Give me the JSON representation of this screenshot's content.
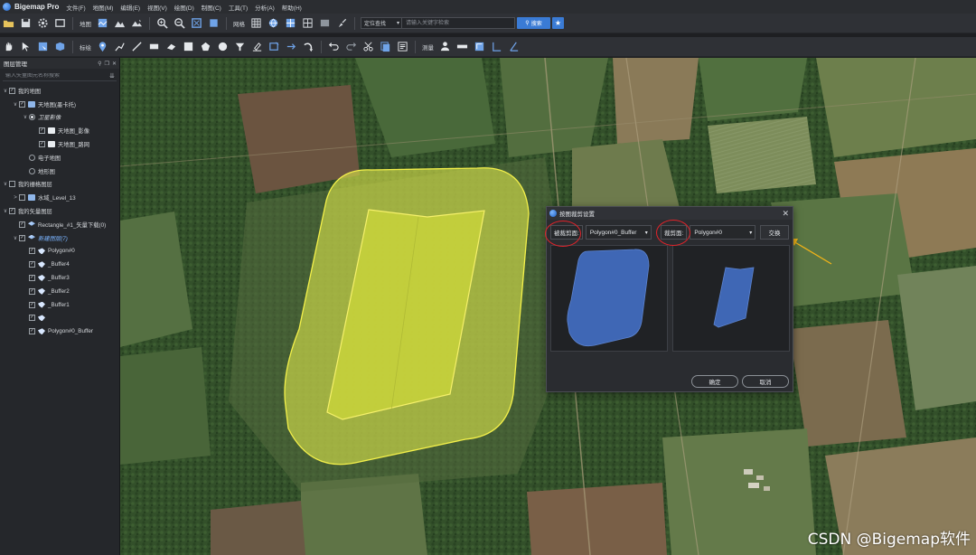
{
  "app": {
    "title": "Bigemap Pro",
    "menu": [
      "文件(F)",
      "地图(M)",
      "编辑(E)",
      "视图(V)",
      "绘图(D)",
      "制图(C)",
      "工具(T)",
      "分析(A)",
      "帮助(H)"
    ]
  },
  "toolbar1": {
    "map_label": "地图",
    "grid_label": "网格",
    "locate_select": "定位查找",
    "search_placeholder": "请输入关键字检索",
    "search_button": "搜索"
  },
  "toolbar2": {
    "plot_label": "标绘",
    "measure_label": "测量"
  },
  "layer_panel": {
    "title": "图层管理",
    "search_placeholder": "输入矢量图元名称搜索",
    "tree": [
      {
        "label": "我的地图",
        "level": 0,
        "expander": "∨",
        "control": "check",
        "checked": true,
        "icon": "none"
      },
      {
        "label": "天地图(墨卡托)",
        "level": 1,
        "expander": "∨",
        "control": "check",
        "checked": true,
        "icon": "folder"
      },
      {
        "label": "卫星影像",
        "level": 2,
        "expander": "∨",
        "control": "radio",
        "checked": true,
        "icon": "none",
        "style": "italic"
      },
      {
        "label": "天地图_影像",
        "level": 3,
        "expander": "",
        "control": "check",
        "checked": true,
        "icon": "map"
      },
      {
        "label": "天地图_路网",
        "level": 3,
        "expander": "",
        "control": "check",
        "checked": true,
        "icon": "map"
      },
      {
        "label": "电子地图",
        "level": 2,
        "expander": "",
        "control": "radio",
        "checked": false,
        "icon": "none"
      },
      {
        "label": "地形图",
        "level": 2,
        "expander": "",
        "control": "radio",
        "checked": false,
        "icon": "none"
      },
      {
        "label": "我的栅格图层",
        "level": 0,
        "expander": "∨",
        "control": "check",
        "checked": false,
        "icon": "none"
      },
      {
        "label": "水域_Level_13",
        "level": 1,
        "expander": ">",
        "control": "check",
        "checked": false,
        "icon": "folder"
      },
      {
        "label": "我的矢量图层",
        "level": 0,
        "expander": "∨",
        "control": "check",
        "checked": true,
        "icon": "none"
      },
      {
        "label": "Rectangle_#1_矢量下载(0)",
        "level": 1,
        "expander": "",
        "control": "check",
        "checked": true,
        "icon": "layer"
      },
      {
        "label": "新建图层(7)",
        "level": 1,
        "expander": "∨",
        "control": "check",
        "checked": true,
        "icon": "layer",
        "style": "blue"
      },
      {
        "label": "Polygon#0",
        "level": 2,
        "expander": "",
        "control": "check",
        "checked": true,
        "icon": "poly"
      },
      {
        "label": "_Buffer4",
        "level": 2,
        "expander": "",
        "control": "check",
        "checked": true,
        "icon": "poly"
      },
      {
        "label": "_Buffer3",
        "level": 2,
        "expander": "",
        "control": "check",
        "checked": true,
        "icon": "poly"
      },
      {
        "label": "_Buffer2",
        "level": 2,
        "expander": "",
        "control": "check",
        "checked": true,
        "icon": "poly"
      },
      {
        "label": "_Buffer1",
        "level": 2,
        "expander": "",
        "control": "check",
        "checked": true,
        "icon": "poly"
      },
      {
        "label": "",
        "level": 2,
        "expander": "",
        "control": "check",
        "checked": true,
        "icon": "poly"
      },
      {
        "label": "Polygon#0_Buffer",
        "level": 2,
        "expander": "",
        "control": "check",
        "checked": true,
        "icon": "poly"
      }
    ]
  },
  "dialog": {
    "title": "按图裁剪设置",
    "target_label": "被裁剪面:",
    "target_value": "Polygon#0_Buffer",
    "clip_label": "裁剪面:",
    "clip_value": "Polygon#0",
    "swap_button": "交换",
    "ok_button": "确定",
    "cancel_button": "取消"
  },
  "colors": {
    "accent": "#3a7bd5",
    "buffer_fill": "#d9e24a",
    "polygon_fill": "#c9d43a",
    "preview_fill": "#3f67b5",
    "annotation_red": "#e0232a",
    "annotation_arrow": "#f2b418"
  },
  "watermark": "CSDN @Bigemap软件"
}
